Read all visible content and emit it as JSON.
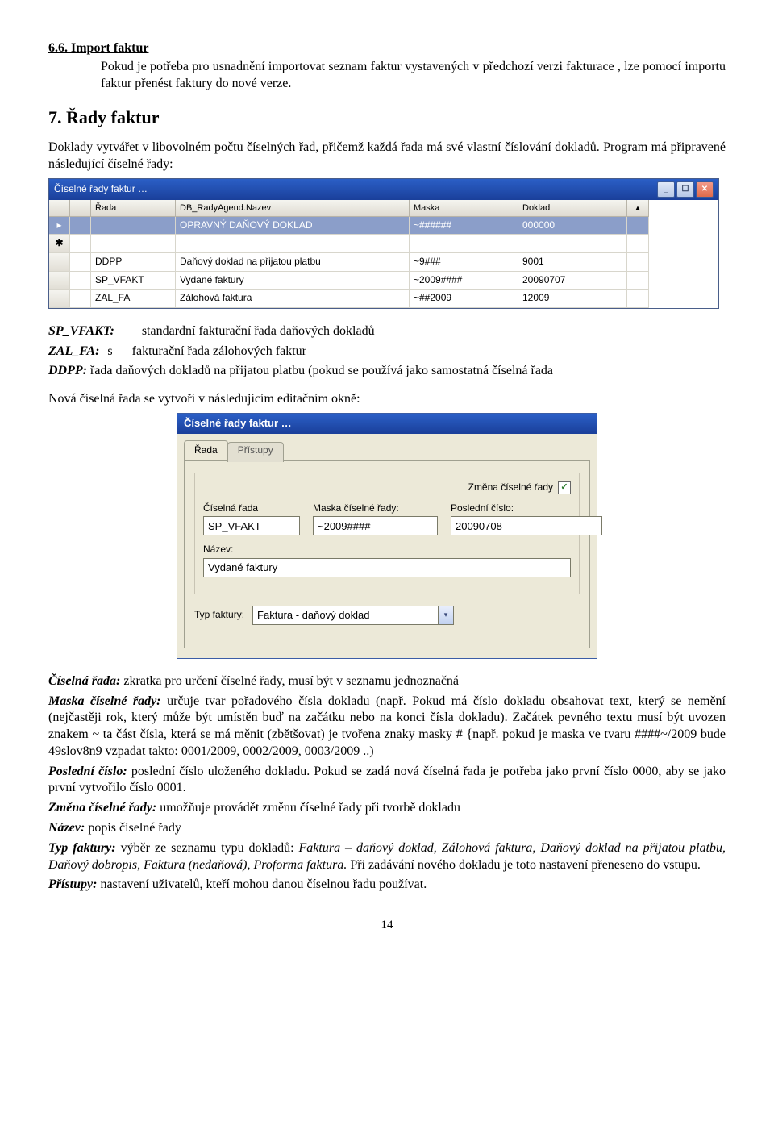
{
  "doc": {
    "sec66_heading": "6.6. Import faktur",
    "sec66_body": "Pokud je potřeba pro usnadnění importovat seznam faktur vystavených v předchozí verzi fakturace , lze pomocí importu faktur přenést faktury do nové verze.",
    "sec7_heading": "7. Řady faktur",
    "sec7_p1": "Doklady vytvářet v libovolném počtu číselných řad, přičemž každá řada má své vlastní číslování dokladů. Program má připravené následující číselné řady:",
    "def_spvfakt_label": "SP_VFAKT:",
    "def_spvfakt_text": "standardní fakturační řada daňových dokladů",
    "def_zalfa_label": "ZAL_FA:",
    "def_zalfa_text": "s      fakturační řada zálohových faktur",
    "def_ddpp": "DDPP: řada daňových dokladů na přijatou platbu (pokud se používá jako samostatná číselná řada",
    "sec7_p2": "Nová číselná řada se vytvoří v následujícím editačním okně:",
    "after": {
      "ciselna_rada": "zkratka pro určení číselné řady, musí být v seznamu jednoznačná",
      "maska": "určuje tvar pořadového čísla dokladu (např. Pokud má číslo dokladu obsahovat text, který se nemění (nejčastěji rok, který může být umístěn buď na začátku nebo na konci čísla dokladu). Začátek pevného textu musí být uvozen znakem ~ ta část čísla, která se má měnit (zbětšovat) je tvořena znaky masky # {např. pokud je maska ve tvaru ####~/2009 bude 49slov8n9 vzpadat takto: 0001/2009, 0002/2009, 0003/2009 ..)",
      "posledni": "poslední číslo uloženého dokladu. Pokud se zadá nová číselná řada je potřeba jako první číslo 0000, aby se jako první vytvořilo číslo 0001.",
      "zmena": "umožňuje provádět změnu číselné řady při tvorbě dokladu",
      "nazev": "popis číselné řady",
      "typ": "výběr ze seznamu typu dokladů: Faktura – daňový doklad, Zálohová faktura, Daňový doklad na přijatou platbu, Daňový dobropis, Faktura (nedaňová), Proforma faktura. Při zadávání nového dokladu je toto nastavení přeneseno do vstupu.",
      "pristupy": "nastavení uživatelů, kteří mohou danou číselnou řadu používat."
    },
    "pagenum": "14"
  },
  "shot1": {
    "title": "Číselné řady faktur …",
    "headers": [
      "",
      "",
      "Řada",
      "DB_RadyAgend.Nazev",
      "Maska",
      "Doklad",
      ""
    ],
    "rows": [
      {
        "mark": "▸",
        "rada": "",
        "nazev": "OPRAVNÝ DAŇOVÝ DOKLAD",
        "maska": "~######",
        "doklad": "000000",
        "sel": true
      },
      {
        "mark": "✱",
        "rada": "",
        "nazev": "",
        "maska": "",
        "doklad": "",
        "new": true
      },
      {
        "mark": "",
        "rada": "DDPP",
        "nazev": "Daňový doklad na přijatou platbu",
        "maska": "~9###",
        "doklad": "9001"
      },
      {
        "mark": "",
        "rada": "SP_VFAKT",
        "nazev": "Vydané faktury",
        "maska": "~2009####",
        "doklad": "20090707"
      },
      {
        "mark": "",
        "rada": "ZAL_FA",
        "nazev": "Zálohová faktura",
        "maska": "~##2009",
        "doklad": "12009"
      }
    ]
  },
  "shot2": {
    "title": "Číselné řady faktur …",
    "tabs": [
      "Řada",
      "Přístupy"
    ],
    "labels": {
      "zmena": "Změna číselné řady",
      "ciselna": "Číselná řada",
      "maska": "Maska číselné řady:",
      "posledni": "Poslední číslo:",
      "nazev": "Název:",
      "typ": "Typ faktury:"
    },
    "values": {
      "zmena_checked": "✓",
      "ciselna": "SP_VFAKT",
      "maska": "~2009####",
      "posledni": "20090708",
      "nazev": "Vydané faktury",
      "typ": "Faktura - daňový doklad"
    }
  }
}
